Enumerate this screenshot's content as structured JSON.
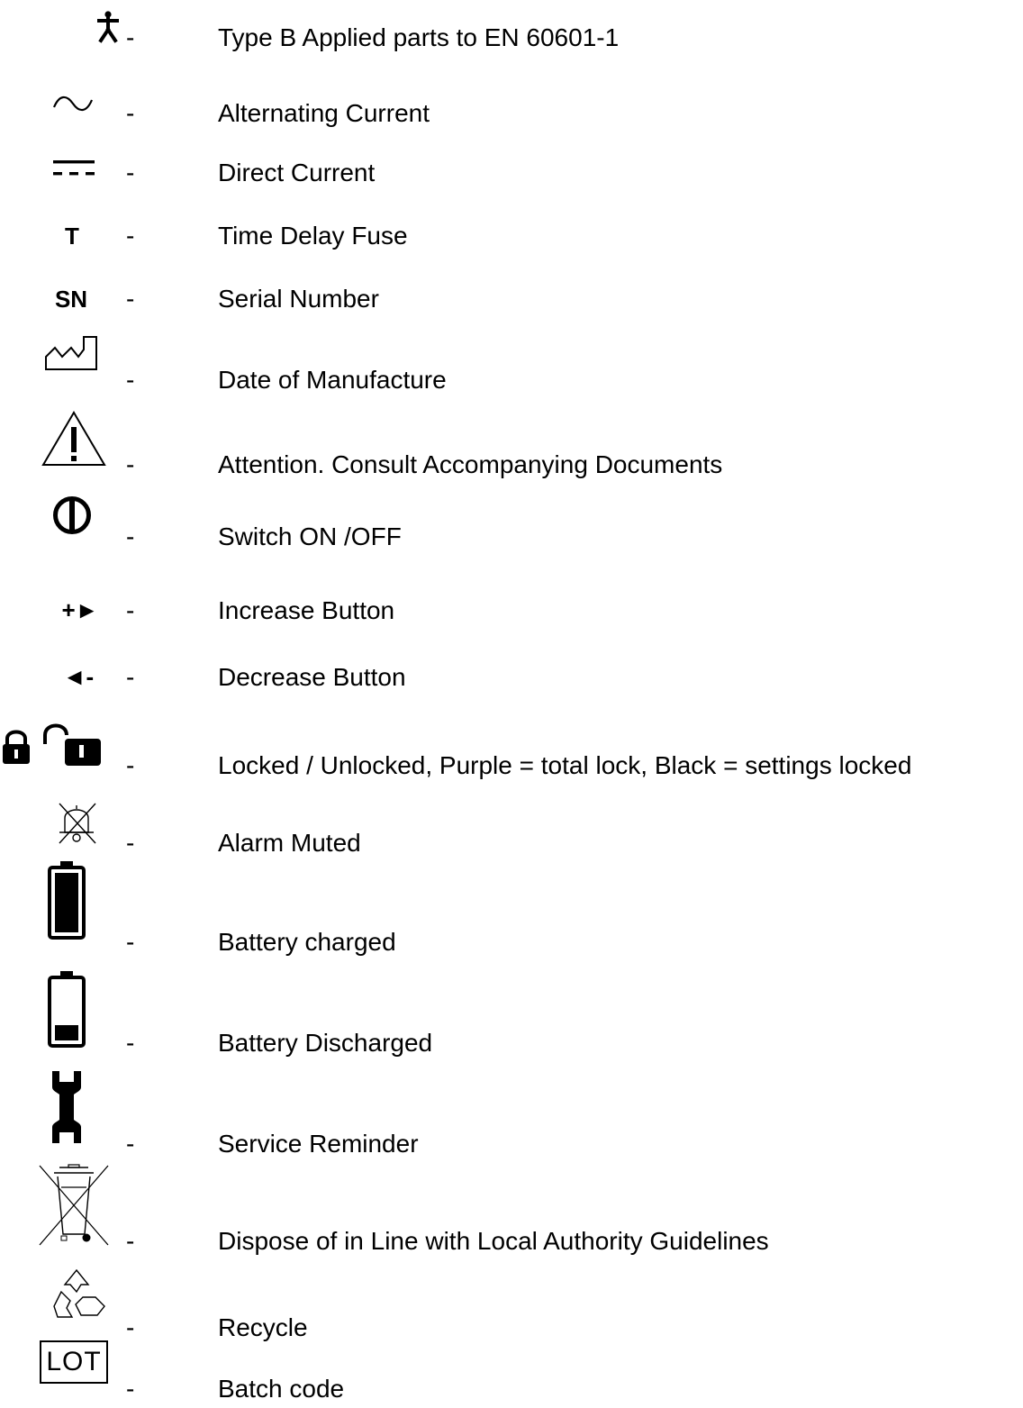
{
  "symbols": [
    {
      "icon": "type-b-applied-part-icon",
      "dash": "-",
      "description": "Type B Applied parts to EN 60601-1"
    },
    {
      "icon": "alternating-current-icon",
      "dash": "-",
      "description": "Alternating Current"
    },
    {
      "icon": "direct-current-icon",
      "dash": "-",
      "description": "Direct Current"
    },
    {
      "icon": "time-delay-fuse-icon",
      "symbol_text": "T",
      "dash": "-",
      "description": "Time Delay Fuse"
    },
    {
      "icon": "serial-number-icon",
      "symbol_text": "SN",
      "dash": "-",
      "description": "Serial Number"
    },
    {
      "icon": "date-of-manufacture-icon",
      "dash": "-",
      "description": "Date of Manufacture"
    },
    {
      "icon": "warning-triangle-icon",
      "dash": "-",
      "description": "Attention. Consult Accompanying Documents"
    },
    {
      "icon": "power-switch-icon",
      "dash": "-",
      "description": "Switch ON /OFF"
    },
    {
      "icon": "increase-button-icon",
      "symbol_text": "+►",
      "dash": "-",
      "description": "Increase Button"
    },
    {
      "icon": "decrease-button-icon",
      "symbol_text": "◄-",
      "dash": "-",
      "description": "Decrease Button"
    },
    {
      "icon": "lock-unlock-icon",
      "dash": "-",
      "description": "Locked / Unlocked, Purple = total lock, Black = settings locked"
    },
    {
      "icon": "alarm-muted-icon",
      "dash": "-",
      "description": "Alarm Muted"
    },
    {
      "icon": "battery-charged-icon",
      "dash": "-",
      "description": "Battery charged"
    },
    {
      "icon": "battery-discharged-icon",
      "dash": "-",
      "description": "Battery Discharged"
    },
    {
      "icon": "service-reminder-icon",
      "dash": "-",
      "description": "Service Reminder"
    },
    {
      "icon": "weee-disposal-icon",
      "dash": "-",
      "description": "Dispose of in Line with Local Authority Guidelines"
    },
    {
      "icon": "recycle-icon",
      "dash": "-",
      "description": "Recycle"
    },
    {
      "icon": "lot-batch-code-icon",
      "symbol_text": "LOT",
      "dash": "-",
      "description": "Batch code"
    }
  ]
}
